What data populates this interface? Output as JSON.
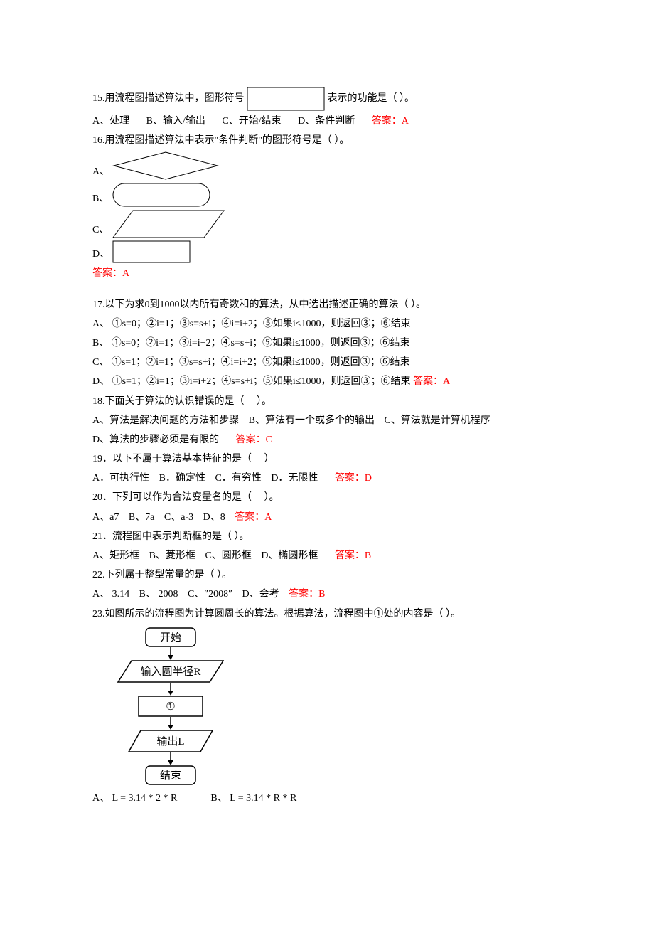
{
  "q15": {
    "prefix": "15.用流程图描述算法中，图形符号",
    "suffix": "表示的功能是（ ）。",
    "A": "A、处理",
    "B": "B、输入/输出",
    "C": "C、开始/结束",
    "D": "D、条件判断",
    "ans": "答案：A"
  },
  "q16": {
    "text": "16.用流程图描述算法中表示\"条件判断\"的图形符号是（ ）。",
    "A": "A、",
    "B": "B、",
    "C": "C、",
    "D": "D、",
    "ans": "答案：A"
  },
  "q17": {
    "text": "17.以下为求0到1000以内所有奇数和的算法，从中选出描述正确的算法（ ）。",
    "A": "A、 ①s=0；②i=1；③s=s+i；④i=i+2；⑤如果i≤1000，则返回③；⑥结束",
    "B": "B、 ①s=0；②i=1；③i=i+2；④s=s+i；⑤如果i≤1000，则返回③；⑥结束",
    "C": "C、 ①s=1；②i=1；③s=s+i；④i=i+2；⑤如果i≤1000，则返回③；⑥结束",
    "D": "D、 ①s=1；②i=1；③i=i+2；④s=s+i；⑤如果i≤1000，则返回③；⑥结束",
    "ans": "答案：A"
  },
  "q18": {
    "text": "18.下面关于算法的认识错误的是（　 ）。",
    "A": "A、算法是解决问题的方法和步骤",
    "B": "B、算法有一个或多个的输出",
    "C": "C、算法就是计算机程序",
    "D": "D、算法的步骤必须是有限的",
    "ans": "答案：C"
  },
  "q19": {
    "text": "19．以下不属于算法基本特征的是（　 ）",
    "A": "A．可执行性",
    "B": "B．确定性",
    "C": "C．有穷性",
    "D": "D．无限性",
    "ans": "答案：D"
  },
  "q20": {
    "text": "20．下列可以作为合法变量名的是（　 ）。",
    "A": "A、a7",
    "B": "B、7a",
    "C": "C、a-3",
    "D": "D、8",
    "ans": "答案：A"
  },
  "q21": {
    "text": "21．流程图中表示判断框的是（ ）。",
    "A": "A、矩形框",
    "B": "B、菱形框",
    "C": "C、圆形框",
    "D": "D、椭圆形框",
    "ans": "答案：B"
  },
  "q22": {
    "text": "22.下列属于整型常量的是（ ）。",
    "A": "A、 3.14",
    "B": "B、 2008",
    "C": "C、″2008″",
    "D": "D、会考",
    "ans": "答案：B"
  },
  "q23": {
    "text": "23.如图所示的流程图为计算圆周长的算法。根据算法，流程图中①处的内容是（ ）。",
    "flow": {
      "start": "开始",
      "input": "输入圆半径R",
      "process": "①",
      "output": "输出L",
      "end": "结束"
    },
    "A": "A、 L = 3.14 * 2 * R",
    "B": "B、 L = 3.14 * R * R"
  }
}
